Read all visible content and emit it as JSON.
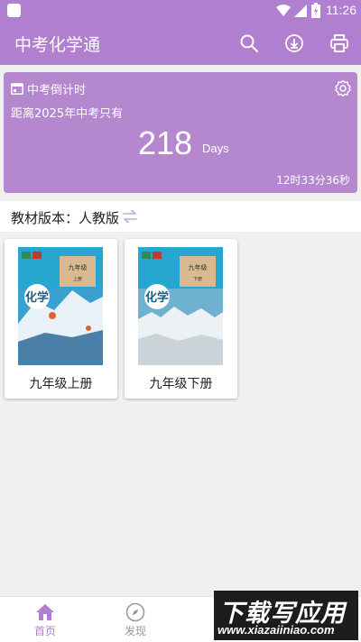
{
  "status_bar": {
    "time": "11:26"
  },
  "app_bar": {
    "title": "中考化学通",
    "actions": [
      "search-icon",
      "download-icon",
      "print-icon"
    ]
  },
  "countdown": {
    "header": "中考倒计时",
    "subtitle": "距离2025年中考只有",
    "days": "218",
    "unit": "Days",
    "remaining": "12时33分36秒"
  },
  "edition": {
    "label": "教材版本：人教版"
  },
  "books": [
    {
      "title": "九年级上册",
      "cover_grade": "九年级",
      "cover_volume": "上册",
      "cover_subject": "化学"
    },
    {
      "title": "九年级下册",
      "cover_grade": "九年级",
      "cover_volume": "下册",
      "cover_subject": "化学"
    }
  ],
  "bottom_nav": {
    "items": [
      {
        "label": "首页",
        "active": true
      },
      {
        "label": "发现",
        "active": false
      }
    ]
  },
  "watermark": {
    "line1": "下载写应用",
    "line2": "www.xiazaiiniao.com"
  },
  "colors": {
    "accent": "#b07fd0",
    "card": "#b487cf",
    "nav_active": "#b07fd0",
    "nav_inactive": "#999999"
  }
}
